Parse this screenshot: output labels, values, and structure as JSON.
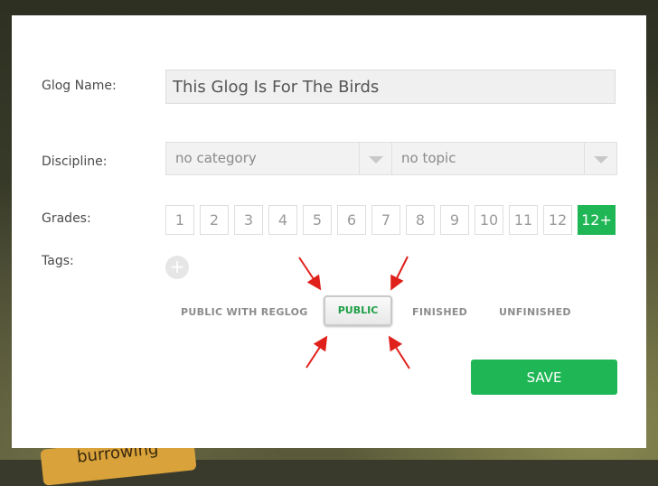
{
  "background": {
    "sign_text": "burrowing"
  },
  "form": {
    "name_label": "Glog Name:",
    "name_value": "This Glog Is For The Birds",
    "discipline_label": "Discipline:",
    "category_value": "no category",
    "topic_value": "no topic",
    "grades_label": "Grades:",
    "grades": [
      "1",
      "2",
      "3",
      "4",
      "5",
      "6",
      "7",
      "8",
      "9",
      "10",
      "11",
      "12",
      "12+"
    ],
    "selected_grade": "12+",
    "tags_label": "Tags:",
    "add_tag_symbol": "+"
  },
  "visibility": {
    "options": [
      "PUBLIC WITH REGLOG",
      "PUBLIC",
      "FINISHED",
      "UNFINISHED"
    ],
    "selected": "PUBLIC"
  },
  "save_label": "SAVE",
  "colors": {
    "accent": "#1fb655",
    "annotation_arrow": "#e0201a"
  }
}
